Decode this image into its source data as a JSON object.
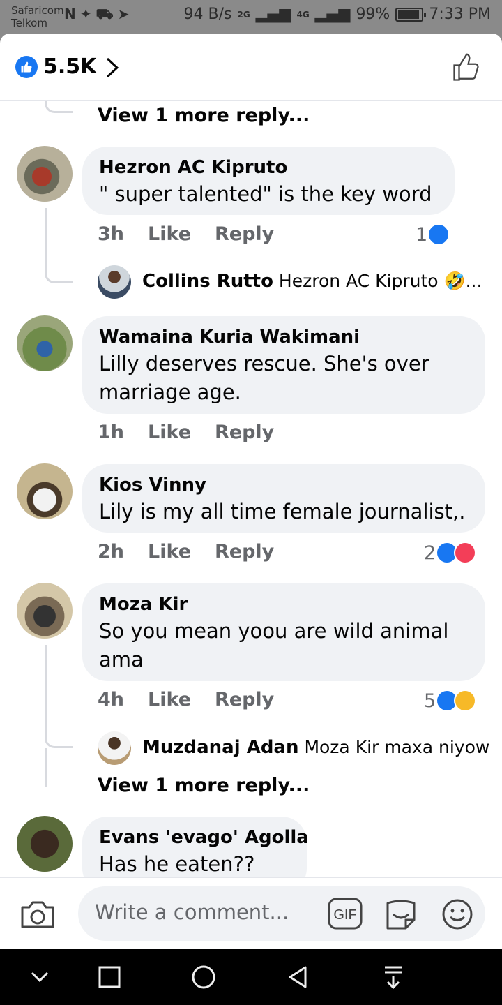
{
  "status_bar": {
    "carrier_1": "Safaricom",
    "carrier_2": "Telkom",
    "net_speed": "94 B/s",
    "sig1": "2G",
    "sig2": "4G",
    "battery": "99%",
    "time": "7:33 PM"
  },
  "header": {
    "reaction_count": "5.5K"
  },
  "top_view_more": "View 1 more reply...",
  "comments": [
    {
      "author": "Hezron AC Kipruto",
      "text": "\" super talented\" is the key word",
      "time": "3h",
      "like": "Like",
      "reply": "Reply",
      "reaction_count": "1",
      "reactions": [
        "like"
      ],
      "reply_preview": {
        "author": "Collins Rutto",
        "text": "Hezron AC Kipruto 🤣..."
      }
    },
    {
      "author": "Wamaina Kuria Wakimani",
      "text": "Lilly deserves rescue. She's over marriage age.",
      "time": "1h",
      "like": "Like",
      "reply": "Reply"
    },
    {
      "author": "Kios Vinny",
      "text": "Lily is my all time female journalist,.",
      "time": "2h",
      "like": "Like",
      "reply": "Reply",
      "reaction_count": "2",
      "reactions": [
        "like",
        "love"
      ]
    },
    {
      "author": "Moza Kir",
      "text": "So you mean yoou are wild animal ama",
      "time": "4h",
      "like": "Like",
      "reply": "Reply",
      "reaction_count": "5",
      "reactions": [
        "like",
        "haha"
      ],
      "reply_preview": {
        "author": "Muzdanaj Adan",
        "text": "Moza Kir maxa niyow"
      },
      "view_more": "View 1 more reply..."
    },
    {
      "author": "Evans 'evago' Agolla",
      "text": "Has he eaten??"
    }
  ],
  "composer": {
    "placeholder": "Write a comment...",
    "gif_label": "GIF"
  },
  "icons": {
    "header": [
      "like-badge-icon",
      "chevron-right-icon",
      "thumbs-up-outline-icon"
    ],
    "composer": [
      "camera-icon",
      "gif-icon",
      "sticker-icon",
      "emoji-icon"
    ],
    "nav": [
      "chevron-down-icon",
      "recents-square-icon",
      "home-circle-icon",
      "back-triangle-icon",
      "notification-pull-icon"
    ]
  },
  "colors": {
    "accent": "#1877f2",
    "love": "#f33e58",
    "haha": "#f7b928",
    "bubble": "#f0f2f5",
    "secondary_text": "#65676b"
  }
}
